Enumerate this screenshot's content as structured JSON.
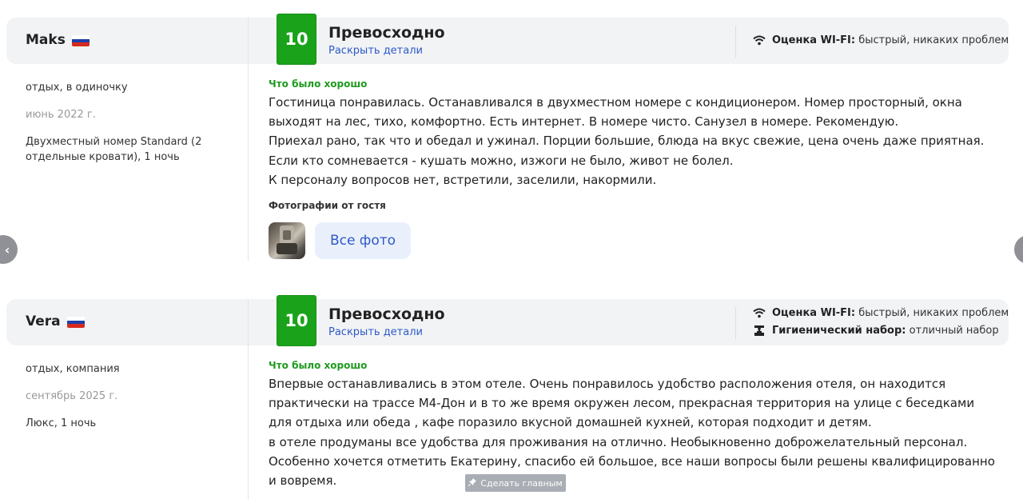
{
  "reviews": [
    {
      "author": "Maks",
      "score": "10",
      "rating_title": "Превосходно",
      "details_link": "Раскрыть детали",
      "amenities": [
        {
          "icon": "wifi-icon",
          "label": "Оценка WI-FI:",
          "value": "быстрый, никаких проблем"
        }
      ],
      "travel_type": "отдых, в одиночку",
      "date": "июнь 2022 г.",
      "room": "Двухместный номер Standard (2 отдельные кровати), 1 ночь",
      "good_label": "Что было хорошо",
      "text_lines": [
        "Гостиница понравилась. Останавливался в двухместном номере с кондиционером. Номер просторный, окна выходят на лес, тихо, комфортно. Есть интернет. В номере чисто. Санузел в номере. Рекомендую.",
        "Приехал рано, так что и обедал и ужинал. Порции большие, блюда на вкус свежие, цена очень даже приятная.",
        "Если кто сомневается - кушать можно, изжоги не было, живот не болел.",
        "К персоналу вопросов нет, встретили, заселили, накормили."
      ],
      "photos_label": "Фотографии от гостя",
      "all_photos": "Все фото"
    },
    {
      "author": "Vera",
      "score": "10",
      "rating_title": "Превосходно",
      "details_link": "Раскрыть детали",
      "amenities": [
        {
          "icon": "wifi-icon",
          "label": "Оценка WI-FI:",
          "value": "быстрый, никаких проблем"
        },
        {
          "icon": "hygiene-kit-icon",
          "label": "Гигиенический набор:",
          "value": "отличный набор"
        }
      ],
      "travel_type": "отдых, компания",
      "date": "сентябрь 2025 г.",
      "room": "Люкс, 1 ночь",
      "good_label": "Что было хорошо",
      "text_lines": [
        "Впервые останавливались в этом отеле. Очень понравилось удобство расположения отеля, он находится практически на трассе М4-Дон и в то же время окружен лесом, прекрасная территория на улице с беседками для отдыха или обеда , кафе поразило вкусной домашней кухней, которая подходит и детям.",
        "в отеле продуманы все удобства для проживания на отлично. Необыкновенно доброжелательный персонал. Особенно хочется отметить Екатерину, спасибо ей большое, все наши вопросы были решены квалифицированно и вовремя."
      ]
    }
  ],
  "make_main_button": "Сделать главным",
  "colors": {
    "score_green": "#1aa31a",
    "link_blue": "#2d59c8",
    "good_green": "#1f9a1f",
    "header_bg": "#f2f3f5"
  }
}
